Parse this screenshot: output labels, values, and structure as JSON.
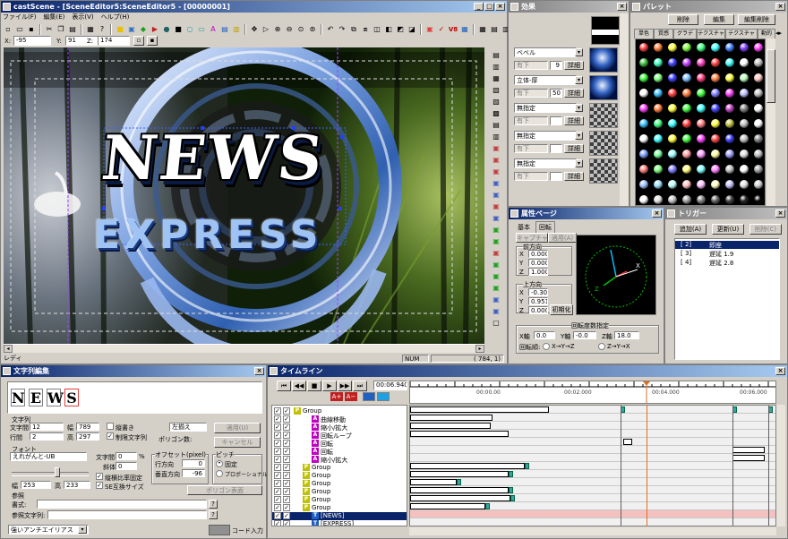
{
  "main": {
    "title": "castScene - [SceneEditor5:SceneEditor5 - [00000001]",
    "menu": [
      "ファイル(F)",
      "編集(E)",
      "表示(V)",
      "ヘルプ(H)"
    ],
    "x_label": "X:",
    "x": "-95",
    "y_label": "Y:",
    "y": "91",
    "z_label": "Z:",
    "z": "174",
    "status_left": "レディ",
    "status_num": "NUM",
    "status_coord": "( 784,  1)"
  },
  "scene": {
    "title_big": "NEWS",
    "subtitle": "EXPRESS"
  },
  "effects": {
    "title": "効果",
    "rows": [
      {
        "name": "ベベル",
        "sub": "有下",
        "num": "9",
        "btn": "詳細"
      },
      {
        "name": "立体-厚",
        "sub": "有下",
        "num": "50",
        "btn": "詳細"
      },
      {
        "name": "無指定",
        "sub": "有下",
        "num": "",
        "btn": "詳細"
      },
      {
        "name": "無指定",
        "sub": "有下",
        "num": "",
        "btn": "詳細"
      },
      {
        "name": "無指定",
        "sub": "有下",
        "num": "",
        "btn": "詳細"
      }
    ]
  },
  "palette": {
    "title": "パレット",
    "buttons": [
      "削除",
      "編集",
      "編集削除"
    ],
    "tabs": [
      "単色",
      "質感",
      "グラデ",
      "テクスチャ",
      "テクスチャ質感",
      "動的"
    ]
  },
  "props": {
    "title": "属性ページ",
    "tabs": [
      "基本",
      "回転"
    ],
    "subtab1": "キャプチャ",
    "subtab2": "適用(A)",
    "front_label": "前方向",
    "front": {
      "x": "0.000",
      "y": "0.000",
      "z": "1.000"
    },
    "up_label": "上方向",
    "up": {
      "x": "-0.309",
      "y": "0.951",
      "z": "0.000"
    },
    "init_btn": "初期化",
    "axis_title": "回転度数指定",
    "x_axis": "X軸",
    "x_val": "0.0",
    "y_axis": "Y軸",
    "y_val": "-0.0",
    "z_axis": "Z軸",
    "z_val": "18.0",
    "order_label": "回転順:",
    "order1": "X→Y→Z",
    "order2": "Z→Y→X"
  },
  "trigger": {
    "title": "トリガー",
    "add": "追加(A)",
    "update": "更新(U)",
    "delete": "削除(C)",
    "items": [
      {
        "idx": "[ 2]",
        "name": "即座"
      },
      {
        "idx": "[ 3]",
        "name": "遅延 1.9"
      },
      {
        "idx": "[ 4]",
        "name": "遅延 2.8"
      }
    ]
  },
  "textedit": {
    "title": "文字列編集",
    "chars": [
      "N",
      "E",
      "W",
      "S"
    ],
    "section_text": "文字列",
    "char_gap": "文字間",
    "char_gap_val": "12",
    "width_label": "幅",
    "width_val": "789",
    "line_gap": "行間",
    "line_gap_val": "2",
    "height_label": "高",
    "height_val": "297",
    "vertical": "縦書き",
    "fixed_text": "制限文字列",
    "align": "左揃え",
    "polygon_count": "ポリゴン数:",
    "apply": "適用(U)",
    "cancel": "キャンセル",
    "section_font": "フォント",
    "font": "えれがんと-UB",
    "spacing": "文字間",
    "spacing_val": "0",
    "slant": "斜体",
    "slant_val": "0",
    "pct": "%",
    "keep_ratio": "縦横比率固定",
    "se_size": "SE互換サイズ",
    "size_w_label": "幅",
    "size_w": "253",
    "size_h_label": "高",
    "size_h": "233",
    "offset": "オフセット(pixel)",
    "row_dir": "行方向",
    "row_dir_val": "0",
    "col_dir": "垂直方向",
    "col_dir_val": "-96",
    "pitch": "ピッチ",
    "fixed": "固定",
    "proportional": "プロポーショナル",
    "polygon_face": "ポリゴン表面",
    "section_ref": "参照",
    "format_label": "書式:",
    "ref_text_label": "参照文字列:",
    "antialias": "強いアンチエイリアス",
    "code_input": "コード入力"
  },
  "timeline": {
    "title": "タイムライン",
    "time": "00:06.940",
    "ruler": [
      "00:00.00",
      "00:02.000",
      "00:04.000",
      "00:06.000"
    ],
    "rows": [
      "Group",
      "曲線移動",
      "縮小/拡大",
      "回転ループ",
      "回転",
      "回転",
      "縮小/拡大",
      "Group",
      "Group",
      "Group",
      "Group",
      "Group",
      "Group",
      "[NEWS]",
      "[EXPRESS]"
    ]
  }
}
